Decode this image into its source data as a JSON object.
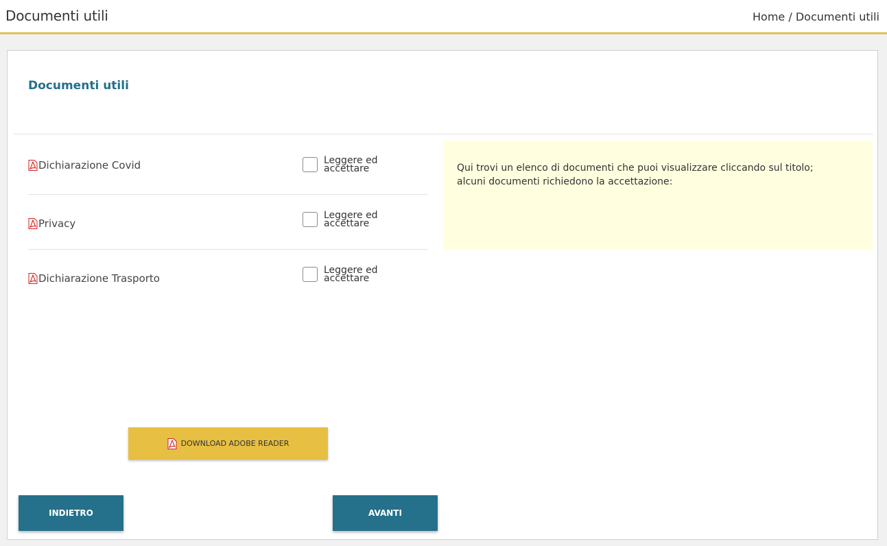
{
  "header": {
    "title": "Documenti utili",
    "breadcrumb": "Home / Documenti utili"
  },
  "card": {
    "title": "Documenti utili"
  },
  "documents": [
    {
      "name": "Dichiarazione Covid",
      "checkbox_label": "Leggere ed accettare",
      "checked": false
    },
    {
      "name": "Privacy",
      "checkbox_label": "Leggere ed accettare",
      "checked": false
    },
    {
      "name": "Dichiarazione Trasporto",
      "checkbox_label": "Leggere ed accettare",
      "checked": false
    }
  ],
  "info": {
    "line1": "Qui trovi un elenco di documenti che puoi visualizzare cliccando sul titolo;",
    "line2": "alcuni documenti richiedono la accettazione:"
  },
  "buttons": {
    "adobe": "DOWNLOAD ADOBE READER",
    "back": "INDIETRO",
    "next": "AVANTI"
  },
  "icons": {
    "document": "pdf-icon",
    "adobe_button": "pdf-icon"
  },
  "colors": {
    "accent_gold": "#e6bf43",
    "header_border": "#e2c255",
    "primary_teal": "#25708a",
    "info_background": "#ffffe0"
  }
}
